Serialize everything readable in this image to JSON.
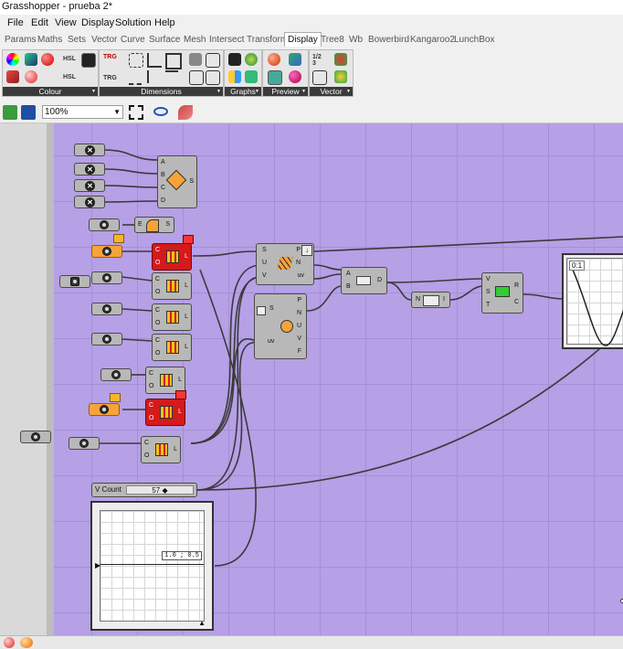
{
  "title": "Grasshopper - prueba 2*",
  "menu": [
    "File",
    "Edit",
    "View",
    "Display",
    "Solution",
    "Help"
  ],
  "tabs": [
    "Params",
    "Maths",
    "Sets",
    "Vector",
    "Curve",
    "Surface",
    "Mesh",
    "Intersect",
    "Transform",
    "Display",
    "Tree8",
    "Wb",
    "Bowerbird",
    "Kangaroo2",
    "LunchBox"
  ],
  "active_tab": "Display",
  "ribbon": {
    "groups": [
      "Colour",
      "Dimensions",
      "Graphs",
      "Preview",
      "Vector"
    ],
    "hsl_top": "HSL",
    "hsl_bottom": "HSL",
    "trg_top": "TRG",
    "trg_bottom": "TRG",
    "vector_text": "1/2\n3"
  },
  "toolbar": {
    "zoom": "100%"
  },
  "nodes": {
    "pt_ports": [
      "A",
      "B",
      "C",
      "D"
    ],
    "pt_out": "S",
    "mini_in": "E",
    "mini_out": "S",
    "co_in1": "C",
    "co_in2": "O",
    "co_out": "L",
    "surf_in": [
      "S",
      "U",
      "V"
    ],
    "surf_out": [
      "P",
      "N",
      "uv"
    ],
    "eval_in": "S",
    "eval_uv": "uv",
    "eval_out": [
      "P",
      "N",
      "U",
      "V",
      "F"
    ],
    "ab_in": [
      "A",
      "B"
    ],
    "ab_out": "D",
    "ni_in": "N",
    "ni_out": "I",
    "vst_in": [
      "V",
      "S",
      "T"
    ],
    "vst_out": [
      "R",
      "C"
    ]
  },
  "slider": {
    "label": "V Count",
    "value": "57"
  },
  "graph_top_label": "0:1",
  "graph_bottom_value": "1.0 ; 0.5"
}
